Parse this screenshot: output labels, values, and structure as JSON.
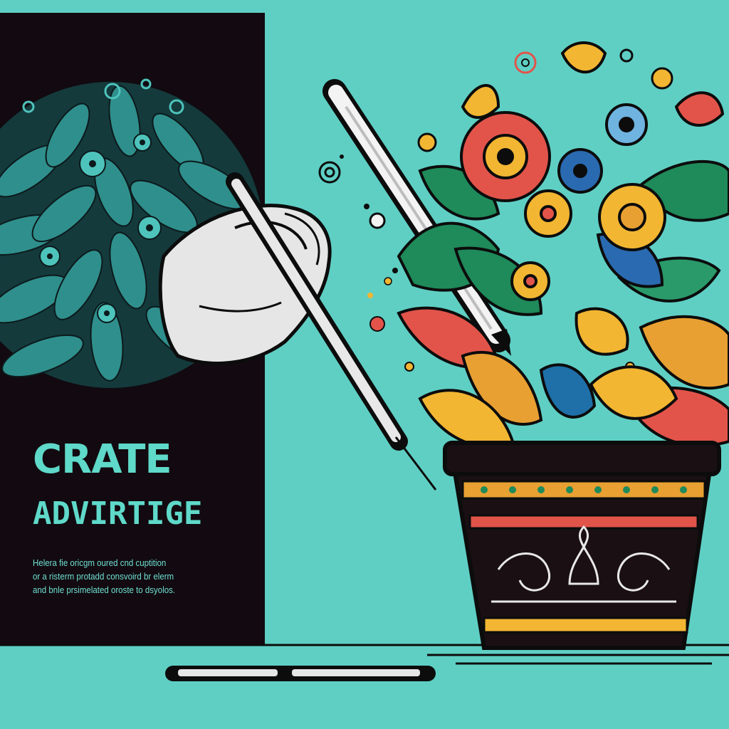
{
  "poster": {
    "headline": "CRATE",
    "subhead": "ADVIRTIGE",
    "body_lines": [
      "Helera fie oricgm oured cnd cuptition",
      "or a risterm protadd consvoird br elerm",
      "and bnle prsimelated oroste to dsyolos."
    ]
  },
  "colors": {
    "background": "#5fcfc4",
    "panel": "#120a10",
    "headline": "#5fd9c9",
    "flower_red": "#e2544a",
    "flower_yellow": "#f2b632",
    "leaf_green": "#1f8a5a",
    "leaf_orange": "#e8a032",
    "pot_dark": "#1a1014"
  },
  "icons": [
    "pen-icon",
    "hand-icon",
    "flower-pot-icon",
    "foliage-circle-icon"
  ]
}
